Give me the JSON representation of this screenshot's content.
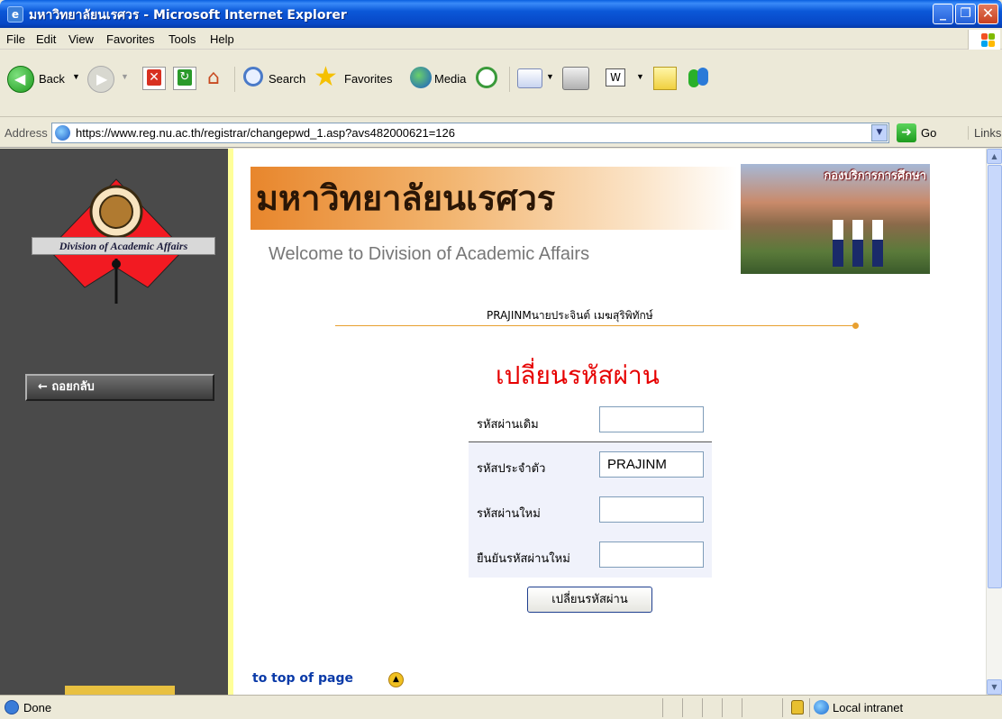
{
  "window": {
    "title": "มหาวิทยาลัยนเรศวร - Microsoft Internet Explorer"
  },
  "menu": {
    "items": [
      "File",
      "Edit",
      "View",
      "Favorites",
      "Tools",
      "Help"
    ]
  },
  "toolbar": {
    "back_label": "Back",
    "search_label": "Search",
    "favorites_label": "Favorites",
    "media_label": "Media"
  },
  "address": {
    "label": "Address",
    "url": "https://www.reg.nu.ac.th/registrar/changepwd_1.asp?avs482000621=126",
    "go_label": "Go",
    "links_label": "Links"
  },
  "sidebar": {
    "logo_text": "Division of Academic Affairs",
    "back_button_label": "← ถอยกลับ"
  },
  "header": {
    "title": "มหาวิทยาลัยนเรศวร",
    "subtitle": "Welcome to Division of Academic Affairs",
    "photo_caption": "กองบริการการศึกษา"
  },
  "main": {
    "user_name": "PRAJINMนายประจินต์ เมฆสุริพิทักษ์",
    "heading": "เปลี่ยนรหัสผ่าน",
    "form": {
      "old_password_label": "รหัสผ่านเดิม",
      "old_password_value": "",
      "user_id_label": "รหัสประจำตัว",
      "user_id_value": "PRAJINM",
      "new_password_label": "รหัสผ่านใหม่",
      "new_password_value": "",
      "confirm_password_label": "ยืนยันรหัสผ่านใหม่",
      "confirm_password_value": ""
    },
    "submit_label": "เปลี่ยนรหัสผ่าน",
    "top_link": "to top of page"
  },
  "status": {
    "text": "Done",
    "zone": "Local intranet"
  },
  "colors": {
    "heading": "#e60000",
    "sidebar": "#4a4a4a",
    "accent": "#e8a030",
    "link": "#0a3aa8"
  }
}
